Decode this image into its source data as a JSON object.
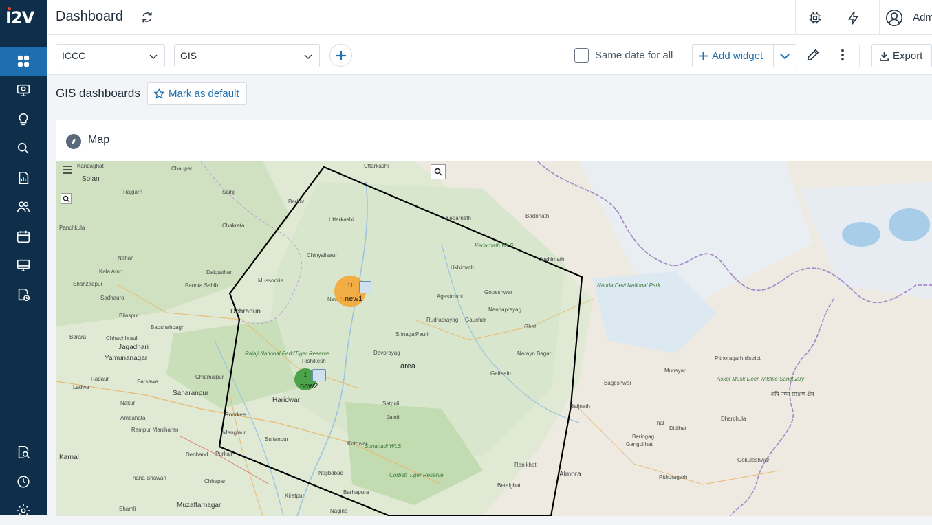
{
  "app": {
    "logo_text": "I2V",
    "title": "Dashboard",
    "user_name": "Adm"
  },
  "sidebar": {
    "top_items": [
      {
        "name": "dashboard",
        "icon": "grid-icon",
        "active": true
      },
      {
        "name": "monitor",
        "icon": "camera-monitor-icon"
      },
      {
        "name": "ideas",
        "icon": "lightbulb-icon"
      },
      {
        "name": "search",
        "icon": "search-icon"
      },
      {
        "name": "reports",
        "icon": "report-icon"
      },
      {
        "name": "users",
        "icon": "users-icon"
      },
      {
        "name": "calendar",
        "icon": "calendar-icon"
      },
      {
        "name": "display",
        "icon": "display-icon"
      },
      {
        "name": "history",
        "icon": "clock-document-icon"
      }
    ],
    "bottom_items": [
      {
        "name": "search-doc",
        "icon": "search-document-icon"
      },
      {
        "name": "history",
        "icon": "history-icon"
      },
      {
        "name": "settings",
        "icon": "gear-icon"
      }
    ]
  },
  "filters": {
    "site_select": "ICCC",
    "type_select": "GIS",
    "same_date_label": "Same date for all",
    "add_widget_label": "Add widget",
    "export_label": "Export"
  },
  "dashboard": {
    "name": "GIS dashboards",
    "mark_default_label": "Mark as default"
  },
  "widget": {
    "title": "Map",
    "area_label": "area",
    "markers": [
      {
        "label": "new1",
        "count": "11"
      },
      {
        "label": "new2",
        "count": "1"
      }
    ],
    "place_labels": [
      "Kandaghat",
      "Solan",
      "Chaupal",
      "Uttarkashi",
      "Rajgarh",
      "Sainj",
      "Barkot",
      "Uttarkashi",
      "Kedarnath",
      "Badrinath",
      "Panchkula",
      "Chakrata",
      "Nahan",
      "Chinyalisaur",
      "Kedarnath WLS",
      "Joshimath",
      "Dakpathar",
      "Kala Amb",
      "Paonta Sahib",
      "Mussoorie",
      "Ukhimath",
      "Nanda Devi National Park",
      "Shahzadpur",
      "Sadhaura",
      "New Tehri",
      "Agastmuni",
      "Gopeshwar",
      "Dehradun",
      "Nandaprayag",
      "Bilaspur",
      "Rudraprayag",
      "Gauchar",
      "Ghat",
      "Badshahbagh",
      "Chhachhrauli",
      "Srinagar",
      "Pauri",
      "Barara",
      "Jagadhari",
      "Yamunanagar",
      "Devprayag",
      "Narayn Bagar",
      "Rishikesh",
      "Gairsain",
      "Rajaji National Park/Tiger Reserve",
      "Chutmalpur",
      "Haridwar",
      "Saharanpur",
      "Sarsawa",
      "Radaur",
      "Ladwa",
      "Nakur",
      "Roorkee",
      "Satpuli",
      "Jainti",
      "Baijnath",
      "Bageshwar",
      "Munsyari",
      "Pithoragarh district",
      "Askot Musk Deer Wildlife Sanctuary",
      "Dharchula",
      "Ambahata",
      "Manglaur",
      "Rampur Maniharan",
      "Sultanpur",
      "Kotdwar",
      "Beringag",
      "Thal",
      "Didihat",
      "Gangolihat",
      "Gokuleshwar",
      "Karnal",
      "Deoband",
      "Purkaji",
      "Sonanadi WLS",
      "Almora",
      "Ranikhet",
      "Thana Bhawan",
      "Chhapar",
      "Najibabad",
      "Corbett Tiger Reserve",
      "Betalghat",
      "Pithoragarh",
      "Kiratpur",
      "Barhapura",
      "Shamli",
      "Muzaffarnagar",
      "Nagina",
      "अपि नम्पा सरक्षण क्षेत्र"
    ]
  },
  "colors": {
    "sidebar_bg": "#0e2e4a",
    "active_nav": "#1e6fb0",
    "accent": "#1e6fb0",
    "cluster_orange": "#f7a32c",
    "cluster_green": "#3c9b3c"
  }
}
